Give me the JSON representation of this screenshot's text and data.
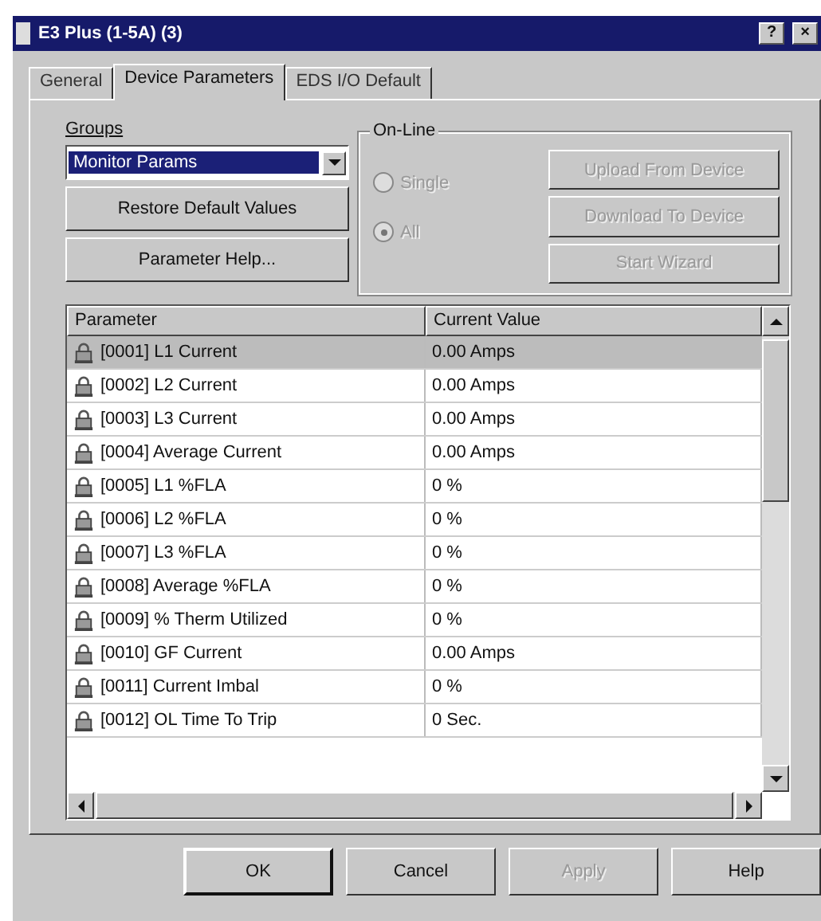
{
  "window": {
    "title": "E3 Plus (1-5A) (3)",
    "controls": [
      "?",
      "×"
    ]
  },
  "tabs": [
    {
      "label": "General",
      "selected": false
    },
    {
      "label": "Device Parameters",
      "selected": true
    },
    {
      "label": "EDS I/O Default",
      "selected": false
    }
  ],
  "groups": {
    "label": "Groups",
    "value": "Monitor Params"
  },
  "left_buttons": [
    "Restore Default Values",
    "Parameter Help..."
  ],
  "online": {
    "title": "On-Line",
    "radios": [
      {
        "label": "Single",
        "selected": false,
        "disabled": true
      },
      {
        "label": "All",
        "selected": true,
        "disabled": true
      }
    ],
    "buttons": [
      {
        "label": "Upload From Device",
        "disabled": true
      },
      {
        "label": "Download To Device",
        "disabled": true
      },
      {
        "label": "Start Wizard",
        "disabled": true
      }
    ]
  },
  "table": {
    "columns": [
      "Parameter",
      "Current Value"
    ],
    "rows": [
      {
        "parameter": "[0001] L1 Current",
        "value": "0.00 Amps",
        "selected": true
      },
      {
        "parameter": "[0002] L2 Current",
        "value": "0.00 Amps",
        "selected": false
      },
      {
        "parameter": "[0003] L3 Current",
        "value": "0.00 Amps",
        "selected": false
      },
      {
        "parameter": "[0004] Average Current",
        "value": "0.00 Amps",
        "selected": false
      },
      {
        "parameter": "[0005] L1 %FLA",
        "value": "0 %",
        "selected": false
      },
      {
        "parameter": "[0006] L2 %FLA",
        "value": "0 %",
        "selected": false
      },
      {
        "parameter": "[0007] L3 %FLA",
        "value": "0 %",
        "selected": false
      },
      {
        "parameter": "[0008] Average %FLA",
        "value": "0 %",
        "selected": false
      },
      {
        "parameter": "[0009] % Therm Utilized",
        "value": "0 %",
        "selected": false
      },
      {
        "parameter": "[0010] GF Current",
        "value": "0.00 Amps",
        "selected": false
      },
      {
        "parameter": "[0011] Current Imbal",
        "value": "0 %",
        "selected": false
      },
      {
        "parameter": "[0012] OL Time To Trip",
        "value": "0 Sec.",
        "selected": false
      }
    ]
  },
  "buttons": [
    {
      "label": "OK",
      "disabled": false
    },
    {
      "label": "Cancel",
      "disabled": false
    },
    {
      "label": "Apply",
      "disabled": true
    },
    {
      "label": "Help",
      "disabled": false
    }
  ]
}
